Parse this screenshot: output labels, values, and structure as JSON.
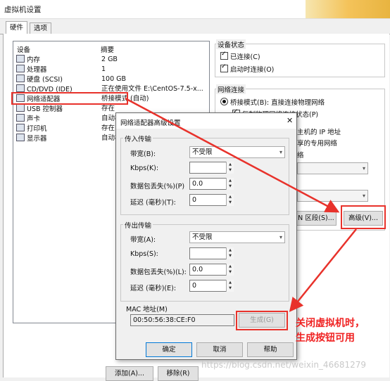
{
  "window": {
    "title": "虚拟机设置"
  },
  "tabs": [
    {
      "label": "硬件"
    },
    {
      "label": "选项"
    }
  ],
  "device_list": {
    "col_device": "设备",
    "col_summary": "摘要",
    "rows": [
      {
        "name": "内存",
        "summary": "2 GB",
        "icon": "memory-icon"
      },
      {
        "name": "处理器",
        "summary": "1",
        "icon": "processor-icon"
      },
      {
        "name": "硬盘 (SCSI)",
        "summary": "100 GB",
        "icon": "hard-disk-icon"
      },
      {
        "name": "CD/DVD (IDE)",
        "summary": "正在使用文件 E:\\CentOS-7.5-x...",
        "icon": "cd-dvd-icon"
      },
      {
        "name": "网络适配器",
        "summary": "桥接模式 (自动)",
        "icon": "network-adapter-icon"
      },
      {
        "name": "USB 控制器",
        "summary": "存在",
        "icon": "usb-icon"
      },
      {
        "name": "声卡",
        "summary": "自动检",
        "icon": "sound-card-icon"
      },
      {
        "name": "打印机",
        "summary": "存在",
        "icon": "printer-icon"
      },
      {
        "name": "显示器",
        "summary": "自动检",
        "icon": "display-icon"
      }
    ]
  },
  "device_status": {
    "title": "设备状态",
    "connected": "已连接(C)",
    "connect_on_power": "启动时连接(O)"
  },
  "network_connection": {
    "title": "网络连接",
    "bridged": "桥接模式(B): 直接连接物理网络",
    "replicate_partial": "复制物理网络连接状态(P)",
    "nat_partial": "主机的 IP 地址",
    "host_partial": "享的专用网络",
    "partial_char": "络",
    "lan_segments_partial": "N 区段(S)...",
    "advanced_button": "高级(V)..."
  },
  "list_buttons": {
    "add": "添加(A)...",
    "remove": "移除(R)"
  },
  "dialog": {
    "title": "网络适配器高级设置",
    "incoming": {
      "title": "传入传输",
      "bandwidth_label": "带宽(B):",
      "bandwidth_value": "不受限",
      "kbps_label": "Kbps(K):",
      "kbps_value": "",
      "loss_label": "数据包丢失(%)(P)",
      "loss_value": "0.0",
      "latency_label": "延迟 (毫秒)(T):",
      "latency_value": "0"
    },
    "outgoing": {
      "title": "传出传输",
      "bandwidth_label": "带宽(A):",
      "bandwidth_value": "不受限",
      "kbps_label": "Kbps(S):",
      "kbps_value": "",
      "loss_label": "数据包丢失(%)(L):",
      "loss_value": "0.0",
      "latency_label": "延迟 (毫秒)(E):",
      "latency_value": "0"
    },
    "mac_label": "MAC 地址(M)",
    "mac_value": "00:50:56:38:CE:F0",
    "generate_button": "生成(G)",
    "ok": "确定",
    "cancel": "取消",
    "help": "帮助"
  },
  "annotation": {
    "line1": "关闭虚拟机时，",
    "line2": "生成按钮可用"
  },
  "watermark": "https://blog.csdn.net/weixin_46681279",
  "colors": {
    "annotation_red": "#e8322b",
    "accent_blue": "#0078d7"
  }
}
